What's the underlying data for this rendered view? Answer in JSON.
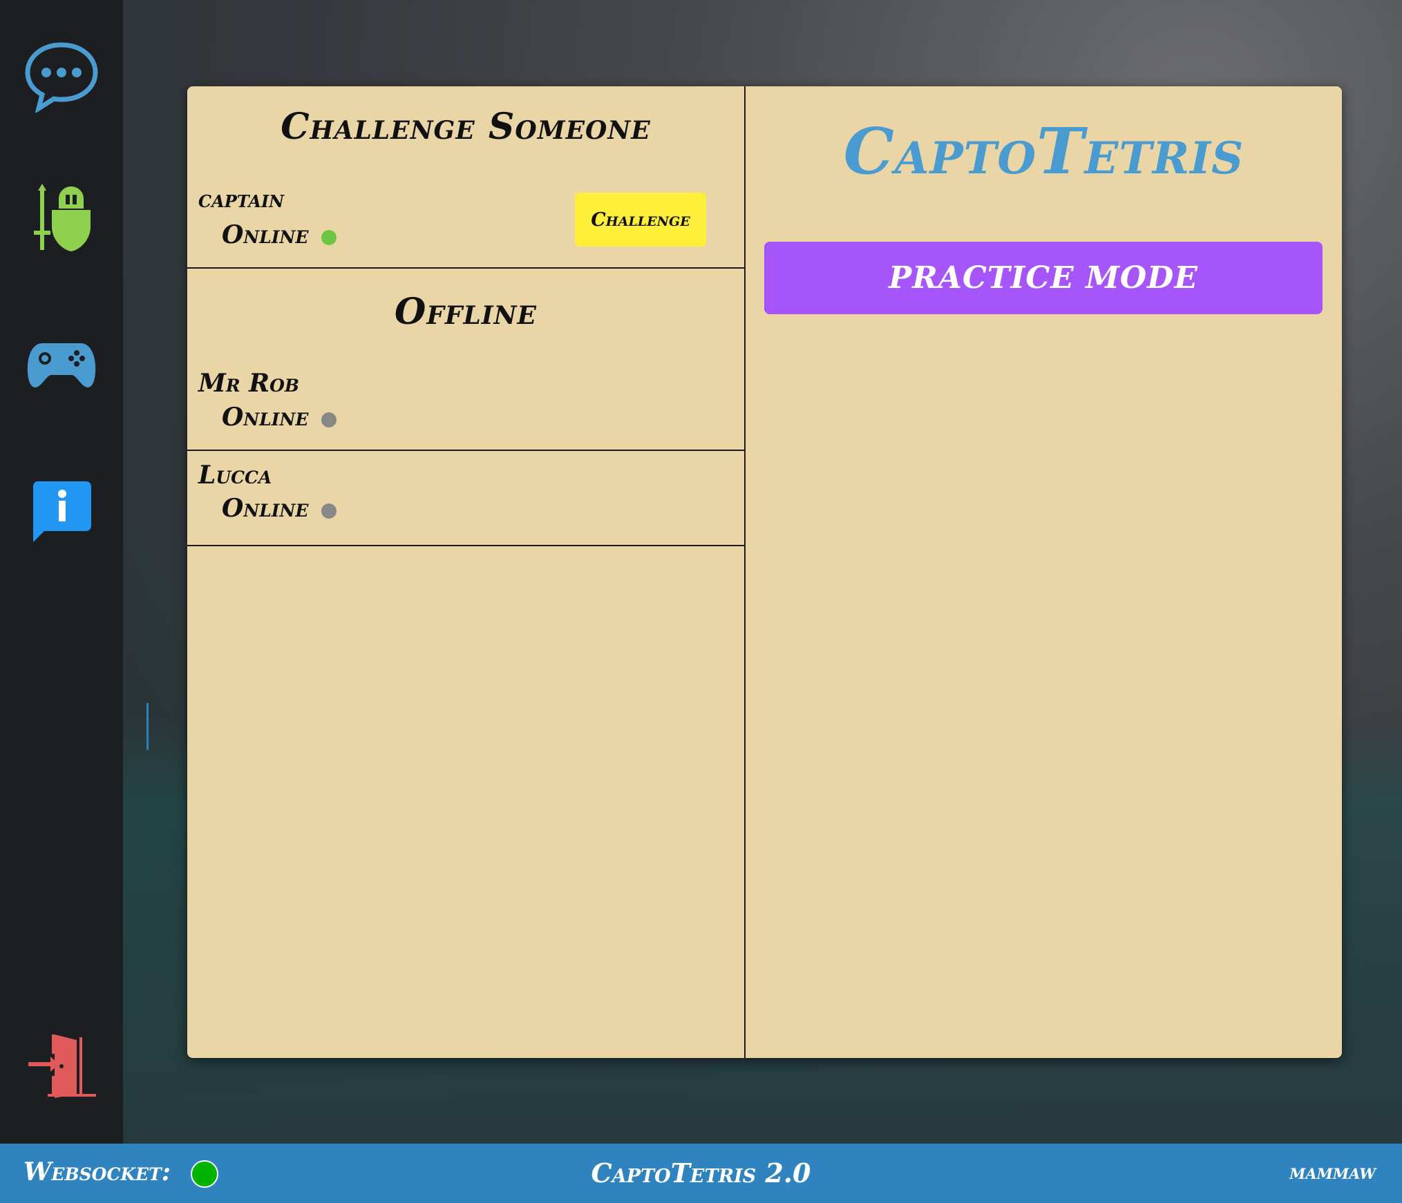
{
  "app": {
    "title": "CaptoTetris",
    "colors": {
      "accent": "#4a9bd0",
      "panel": "#ead5a6",
      "practice": "#a655fb",
      "challenge": "#fdee3a",
      "footer": "#2f84bf",
      "online_dot": "#6cc644",
      "offline_dot": "#888888"
    }
  },
  "sidebar": {
    "items": [
      {
        "icon": "chat-bubble-icon",
        "color": "#4a9bd0"
      },
      {
        "icon": "knight-shield-icon",
        "color": "#8fd14f"
      },
      {
        "icon": "gamepad-icon",
        "color": "#4a9bd0"
      },
      {
        "icon": "info-icon",
        "color": "#2196f3"
      },
      {
        "icon": "exit-door-icon",
        "color": "#e05a5a"
      }
    ]
  },
  "left": {
    "challenge_heading": "Challenge Someone",
    "online_players": [
      {
        "name": "captain",
        "status": "Online",
        "action": "Challenge"
      }
    ],
    "offline_heading": "Offline",
    "offline_players": [
      {
        "name": "Mr Rob",
        "status": "Online"
      },
      {
        "name": "Lucca",
        "status": "Online"
      }
    ]
  },
  "right": {
    "title": "CaptoTetris",
    "practice_label": "PRACTICE MODE"
  },
  "footer": {
    "websocket_label": "Websocket:",
    "websocket_status_color": "#00b400",
    "title": "CaptoTetris 2.0",
    "user": "mammaw"
  }
}
